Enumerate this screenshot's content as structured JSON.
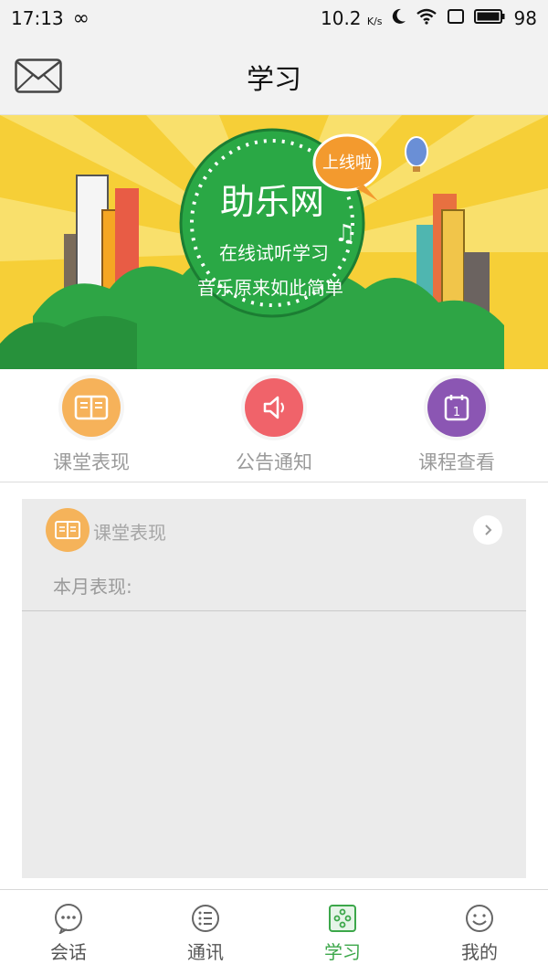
{
  "status_bar": {
    "time": "17:13",
    "infinity": "∞",
    "network_speed": "10.2",
    "speed_unit": "K/s",
    "battery": "98"
  },
  "nav": {
    "title": "学习"
  },
  "banner": {
    "brand": "助乐网",
    "badge": "上线啦",
    "line1": "在线试听学习",
    "line2": "音乐原来如此简单"
  },
  "quick_actions": [
    {
      "label": "课堂表现",
      "color": "#f6b25a"
    },
    {
      "label": "公告通知",
      "color": "#f0636a"
    },
    {
      "label": "课程查看",
      "color": "#8b56b3"
    }
  ],
  "card": {
    "title": "课堂表现",
    "subtitle": "本月表现:"
  },
  "tabs": [
    {
      "label": "会话",
      "icon": "chat-icon"
    },
    {
      "label": "通讯",
      "icon": "contacts-icon"
    },
    {
      "label": "学习",
      "icon": "study-icon"
    },
    {
      "label": "我的",
      "icon": "profile-icon"
    }
  ],
  "colors": {
    "accent": "#3ca74a",
    "banner_bg": "#f6cf37",
    "card_bg": "#ebebeb"
  }
}
